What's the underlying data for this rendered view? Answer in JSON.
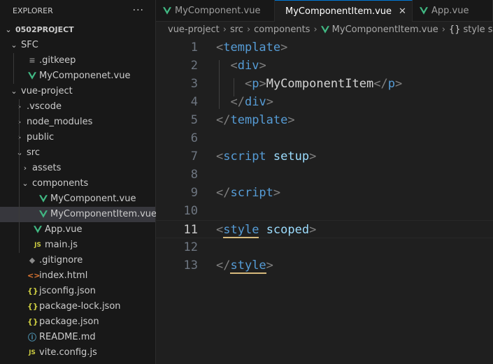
{
  "explorer": {
    "title": "EXPLORER",
    "more": "···",
    "tree": [
      {
        "label": "0502PROJECT",
        "kind": "root",
        "chevron": "⌄"
      },
      {
        "label": "SFC",
        "kind": "folder",
        "chevron": "⌄"
      },
      {
        "label": ".gitkeep",
        "kind": "file",
        "icon": "dash"
      },
      {
        "label": "MyComponenet.vue",
        "kind": "file",
        "icon": "vue"
      },
      {
        "label": "vue-project",
        "kind": "folder",
        "chevron": "⌄"
      },
      {
        "label": ".vscode",
        "kind": "folder",
        "chevron": "›"
      },
      {
        "label": "node_modules",
        "kind": "folder",
        "chevron": "›"
      },
      {
        "label": "public",
        "kind": "folder",
        "chevron": "›"
      },
      {
        "label": "src",
        "kind": "folder",
        "chevron": "⌄"
      },
      {
        "label": "assets",
        "kind": "folder",
        "chevron": "›"
      },
      {
        "label": "components",
        "kind": "folder",
        "chevron": "⌄"
      },
      {
        "label": "MyComponent.vue",
        "kind": "file",
        "icon": "vue"
      },
      {
        "label": "MyComponentItem.vue",
        "kind": "file",
        "icon": "vue",
        "selected": true
      },
      {
        "label": "App.vue",
        "kind": "file",
        "icon": "vue"
      },
      {
        "label": "main.js",
        "kind": "file",
        "icon": "js"
      },
      {
        "label": ".gitignore",
        "kind": "file",
        "icon": "git"
      },
      {
        "label": "index.html",
        "kind": "file",
        "icon": "html"
      },
      {
        "label": "jsconfig.json",
        "kind": "file",
        "icon": "json"
      },
      {
        "label": "package-lock.json",
        "kind": "file",
        "icon": "json"
      },
      {
        "label": "package.json",
        "kind": "file",
        "icon": "json"
      },
      {
        "label": "README.md",
        "kind": "file",
        "icon": "info"
      },
      {
        "label": "vite.config.js",
        "kind": "file",
        "icon": "js"
      }
    ]
  },
  "tabs": [
    {
      "label": "MyComponent.vue",
      "active": false
    },
    {
      "label": "MyComponentItem.vue",
      "active": true,
      "close": "✕"
    },
    {
      "label": "App.vue",
      "active": false
    }
  ],
  "breadcrumb": {
    "parts": [
      "vue-project",
      "src",
      "components",
      "MyComponentItem.vue",
      "style scoped"
    ],
    "brace_glyph": "{}"
  },
  "editor": {
    "current_line": 11,
    "lines": [
      {
        "n": "1"
      },
      {
        "n": "2"
      },
      {
        "n": "3"
      },
      {
        "n": "4"
      },
      {
        "n": "5"
      },
      {
        "n": "6"
      },
      {
        "n": "7"
      },
      {
        "n": "8"
      },
      {
        "n": "9"
      },
      {
        "n": "10"
      },
      {
        "n": "11"
      },
      {
        "n": "12"
      },
      {
        "n": "13"
      }
    ],
    "tokens": {
      "template": "template",
      "div": "div",
      "p": "p",
      "p_text": "MyComponentItem",
      "script": "script",
      "setup": "setup",
      "style": "style",
      "scoped": "scoped"
    }
  },
  "colors": {
    "vue_green": "#41b883",
    "vue_dark": "#35495e",
    "js_yellow": "#cbcb41",
    "json_yellow": "#cbcb41",
    "html_orange": "#e37933",
    "info_blue": "#519aba",
    "tag_blue": "#569cd6",
    "attr_blue": "#9cdcfe"
  }
}
